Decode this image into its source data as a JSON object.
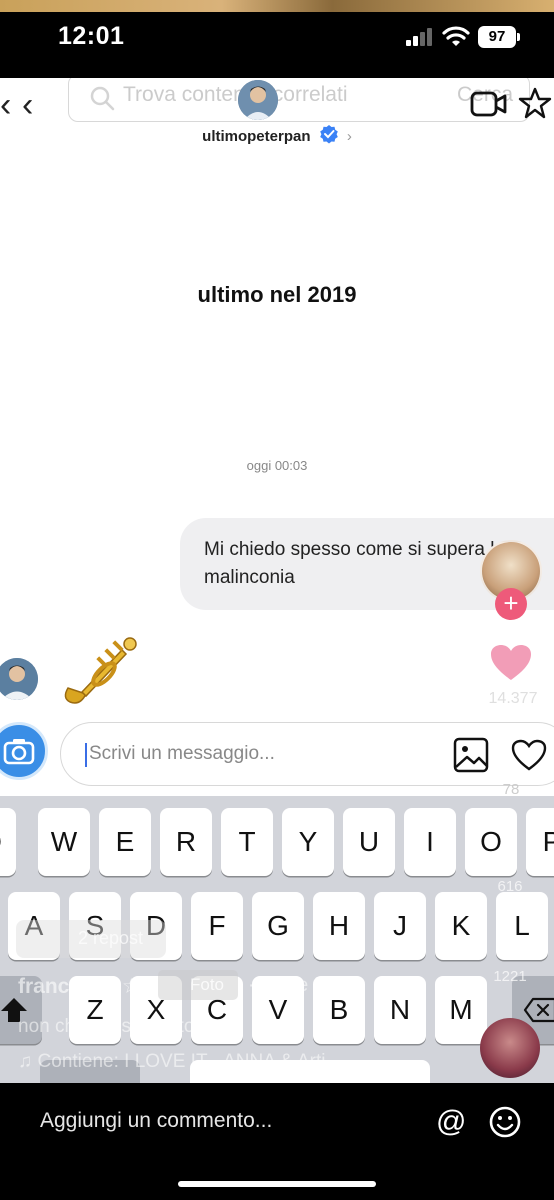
{
  "status": {
    "time": "12:01",
    "battery": "97"
  },
  "header": {
    "search_placeholder": "Trova contenuti correlati",
    "search_action": "Cerca",
    "username": "ultimopeterpan"
  },
  "story": {
    "title": "ultimo nel 2019",
    "timestamp": "oggi 00:03"
  },
  "message": {
    "text": "Mi chiedo spesso come si supera la malinconia"
  },
  "composer": {
    "placeholder": "Scrivi un messaggio..."
  },
  "keyboard": {
    "row1": [
      "Q",
      "W",
      "E",
      "R",
      "T",
      "Y",
      "U",
      "I",
      "O",
      "P"
    ],
    "row2": [
      "A",
      "S",
      "D",
      "F",
      "G",
      "H",
      "J",
      "K",
      "L"
    ],
    "row3": [
      "Z",
      "X",
      "C",
      "V",
      "B",
      "N",
      "M"
    ]
  },
  "post": {
    "like_count": "14.377",
    "comment_count": "78",
    "save_count": "616",
    "share_count": "1221",
    "repost_label": "2 repost",
    "author": "francesca ☆",
    "type_badge": "Foto",
    "posted_ago": "· 16ore fa",
    "caption": "non che avesse torto",
    "music": "♫ Contiene: I LOVE IT - ANNA & Arti..."
  },
  "comment_bar": {
    "placeholder": "Aggiungi un commento..."
  },
  "colors": {
    "accent": "#3a8ee6",
    "like": "#ee5a7a",
    "verified": "#3b82f6"
  }
}
